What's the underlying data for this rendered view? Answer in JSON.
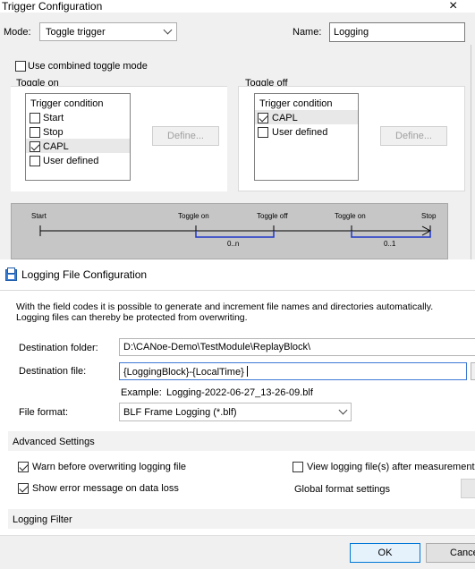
{
  "trigger": {
    "title": "Trigger Configuration",
    "close": "×",
    "mode_label": "Mode:",
    "mode_value": "Toggle trigger",
    "name_label": "Name:",
    "name_value": "Logging",
    "combined_label": "Use combined toggle mode",
    "toggle_on": {
      "title": "Toggle on",
      "header": "Trigger condition",
      "items": [
        {
          "label": "Start",
          "checked": false
        },
        {
          "label": "Stop",
          "checked": false
        },
        {
          "label": "CAPL",
          "checked": true
        },
        {
          "label": "User defined",
          "checked": false
        }
      ],
      "define": "Define..."
    },
    "toggle_off": {
      "title": "Toggle off",
      "header": "Trigger condition",
      "items": [
        {
          "label": "CAPL",
          "checked": true
        },
        {
          "label": "User defined",
          "checked": false
        }
      ],
      "define": "Define..."
    },
    "timeline": {
      "start": "Start",
      "toggle_on_1": "Toggle on",
      "toggle_off": "Toggle off",
      "toggle_on_2": "Toggle on",
      "stop": "Stop",
      "range1": "0..n",
      "range2": "0..1"
    }
  },
  "logging": {
    "title": "Logging File Configuration",
    "info_line1": "With the field codes it is possible to generate and increment file names and directories automatically.",
    "info_line2": "Logging files can thereby be protected from overwriting.",
    "dest_folder_label": "Destination folder:",
    "dest_folder_value": "D:\\CANoe-Demo\\TestModule\\ReplayBlock\\",
    "dest_file_label": "Destination file:",
    "dest_file_value": "{LoggingBlock}-{LocalTime}",
    "example_label": "Example:",
    "example_value": "Logging-2022-06-27_13-26-09.blf",
    "format_label": "File format:",
    "format_value": "BLF Frame Logging (*.blf)",
    "advanced_title": "Advanced Settings",
    "warn_label": "Warn before overwriting logging file",
    "view_label": "View logging file(s) after measurement st",
    "show_error_label": "Show error message on data loss",
    "global_format_label": "Global format settings",
    "filter_title": "Logging Filter",
    "ok": "OK",
    "cancel": "Cance"
  }
}
